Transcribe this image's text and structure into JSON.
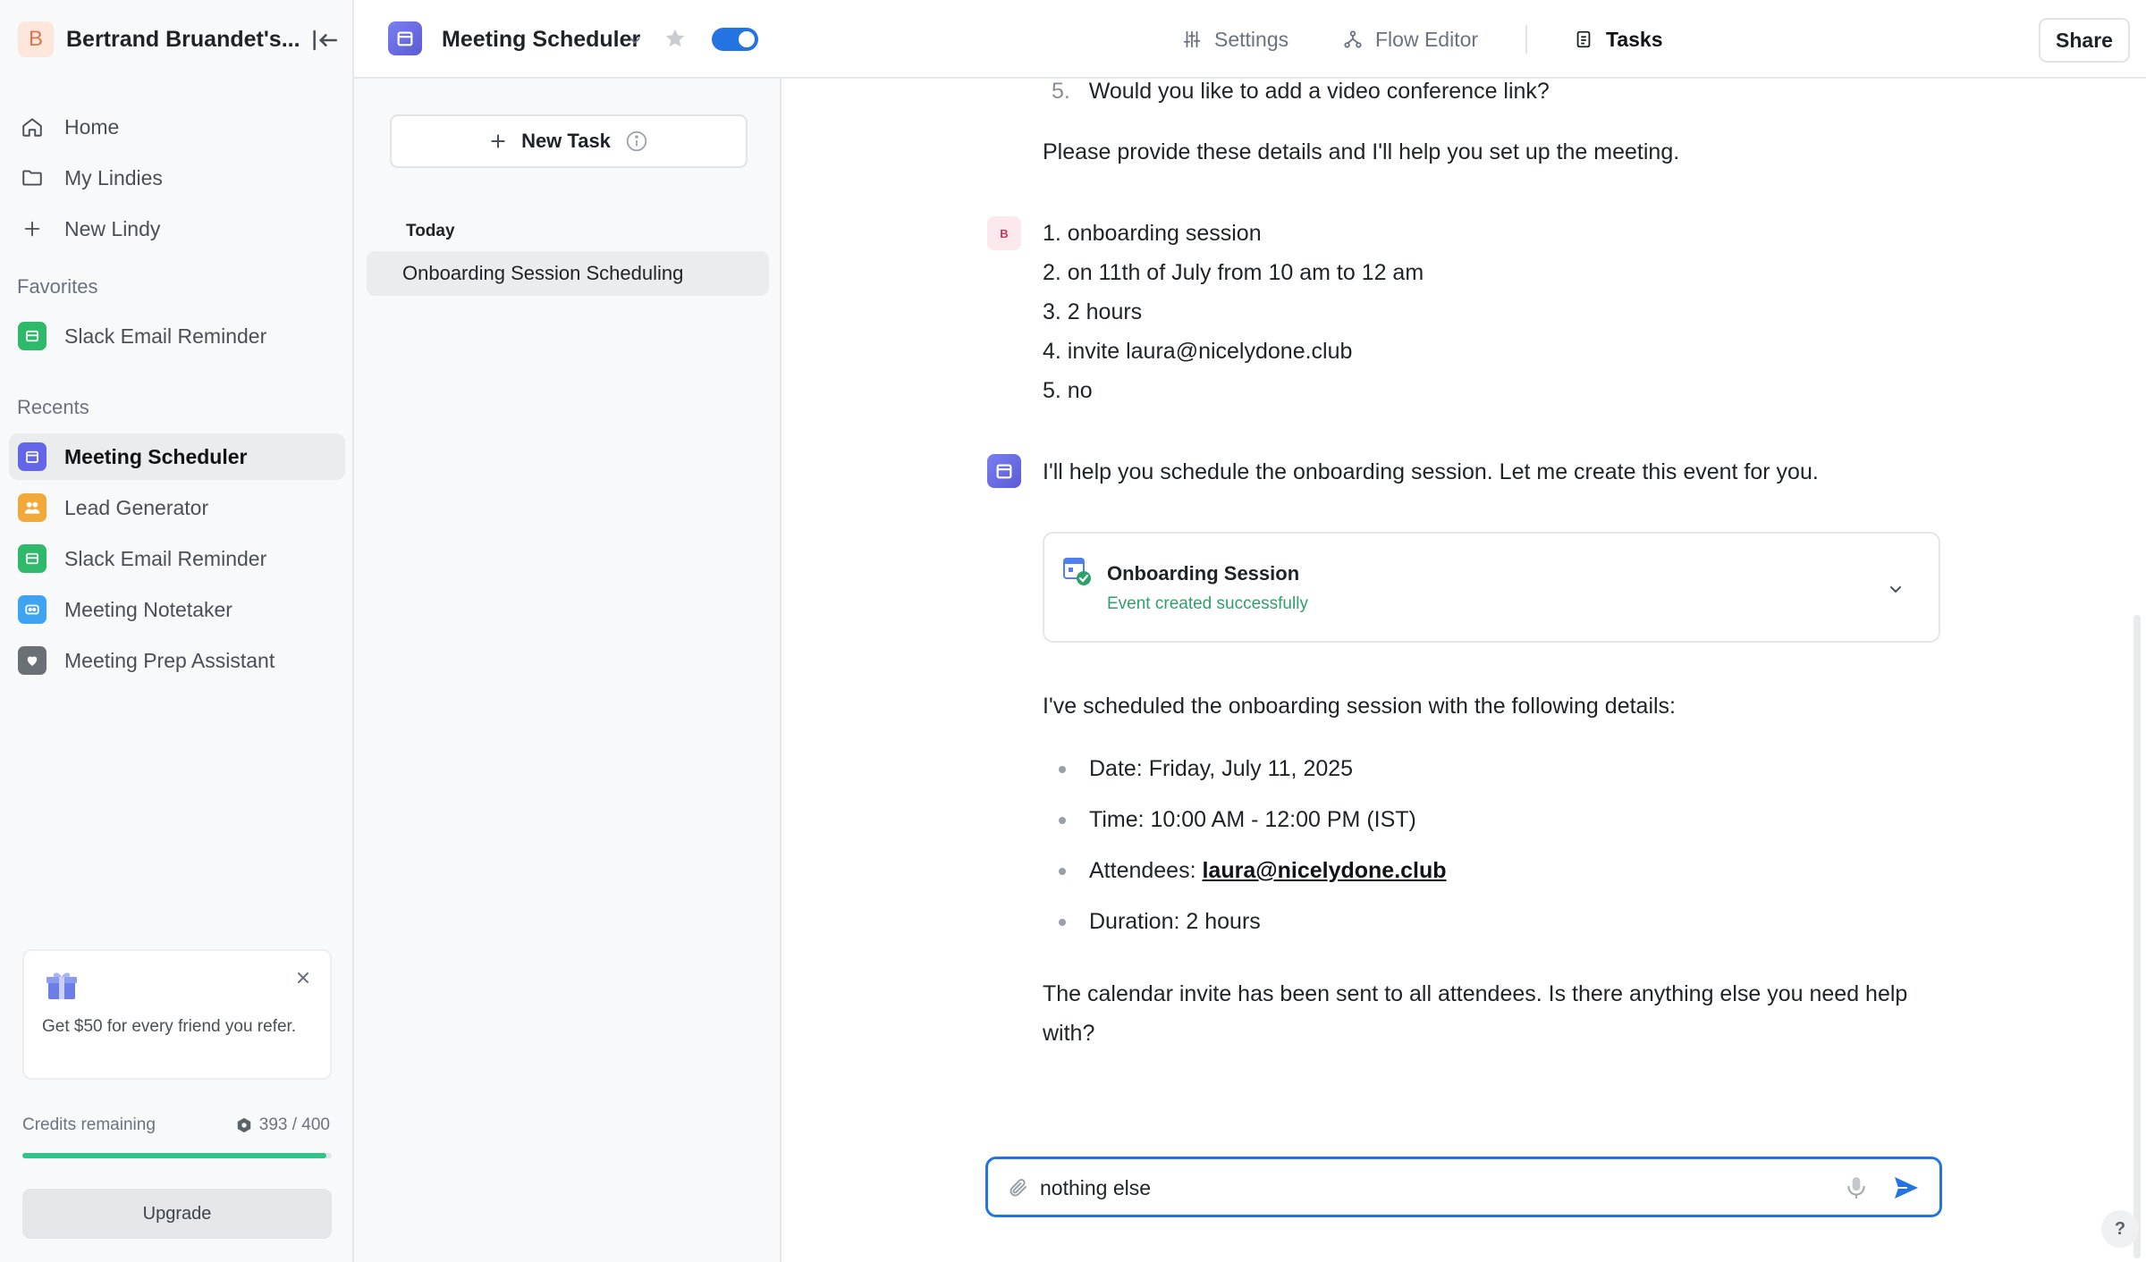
{
  "sidebar": {
    "workspace_initial": "B",
    "workspace_name": "Bertrand Bruandet's...",
    "nav": [
      {
        "label": "Home",
        "icon": "home-icon"
      },
      {
        "label": "My Lindies",
        "icon": "folder-icon"
      },
      {
        "label": "New Lindy",
        "icon": "plus-icon"
      }
    ],
    "favorites_label": "Favorites",
    "favorites": [
      {
        "label": "Slack Email Reminder",
        "icon": "mail-app-icon",
        "color": "#2fb96a"
      }
    ],
    "recents_label": "Recents",
    "recents": [
      {
        "label": "Meeting Scheduler",
        "icon": "calendar-app-icon",
        "color": "#6366e8",
        "active": true
      },
      {
        "label": "Lead Generator",
        "icon": "people-app-icon",
        "color": "#f2a93b"
      },
      {
        "label": "Slack Email Reminder",
        "icon": "mail-app-icon",
        "color": "#2fb96a"
      },
      {
        "label": "Meeting Notetaker",
        "icon": "notetaker-app-icon",
        "color": "#3ea3f0"
      },
      {
        "label": "Meeting Prep Assistant",
        "icon": "heart-app-icon",
        "color": "#6b6f76"
      }
    ],
    "referral_text": "Get $50 for every friend you refer.",
    "credits_label": "Credits remaining",
    "credits_value": "393 / 400",
    "credits_fraction": 0.9825,
    "upgrade_label": "Upgrade"
  },
  "topbar": {
    "agent_name": "Meeting Scheduler",
    "toggle_on": true,
    "tabs": [
      {
        "label": "Settings",
        "icon": "sliders-icon"
      },
      {
        "label": "Flow Editor",
        "icon": "flow-icon"
      },
      {
        "label": "Tasks",
        "icon": "tasks-icon",
        "active": true
      }
    ],
    "share_label": "Share"
  },
  "tasks": {
    "new_task_label": "New Task",
    "group_label": "Today",
    "items": [
      "Onboarding Session Scheduling"
    ]
  },
  "chat": {
    "partial_item_number": "5.",
    "partial_item_text": "Would you like to add a video conference link?",
    "provide_details": "Please provide these details and I'll help you set up the meeting.",
    "user_initial": "B",
    "user_lines": [
      "1. onboarding session",
      "2. on 11th of July from 10 am to 12 am",
      "3. 2 hours",
      "4. invite laura@nicelydone.club",
      "5. no"
    ],
    "bot_reply": "I'll help you schedule the onboarding session. Let me create this event for you.",
    "event_title": "Onboarding Session",
    "event_status": "Event created successfully",
    "scheduled_intro": "I've scheduled the onboarding session with the following details:",
    "details": {
      "date_label": "Date: Friday, July 11, 2025",
      "time_label": "Time: 10:00 AM - 12:00 PM (IST)",
      "attendees_prefix": "Attendees: ",
      "attendees_email": "laura@nicelydone.club",
      "duration_label": "Duration: 2 hours"
    },
    "closing": "The calendar invite has been sent to all attendees. Is there anything else you need help with?",
    "composer_value": "nothing else",
    "help_label": "?"
  },
  "colors": {
    "accent": "#2374e1",
    "success": "#2ea16a",
    "credits_bar": "#2ec48a"
  }
}
